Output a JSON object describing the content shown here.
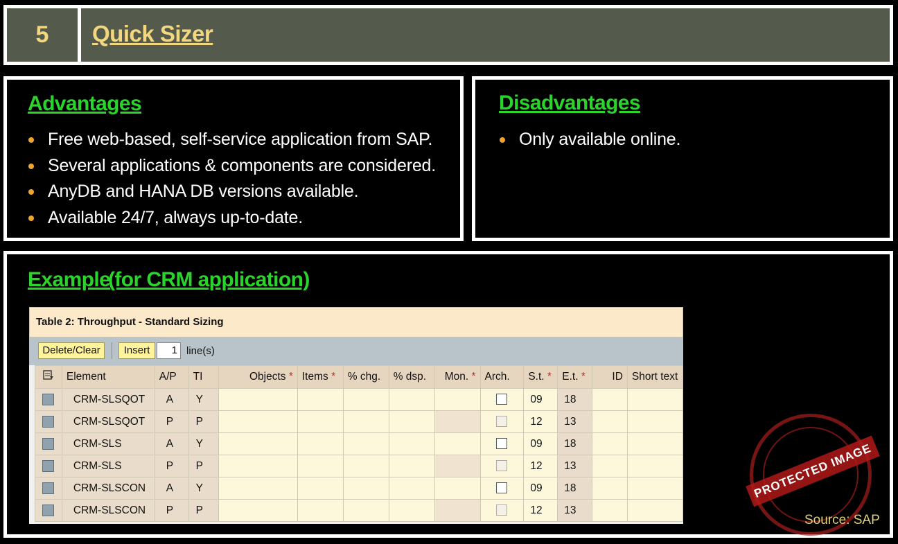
{
  "header": {
    "number": "5",
    "title": "Quick Sizer"
  },
  "advantages": {
    "title": "Advantages",
    "items": [
      "Free web-based, self-service application from SAP.",
      "Several applications & components are considered.",
      "AnyDB and HANA DB versions available.",
      "Available 24/7, always up-to-date."
    ]
  },
  "disadvantages": {
    "title": "Disadvantages",
    "items": [
      "Only available online."
    ]
  },
  "example": {
    "title": "Example",
    "subtitle": "(for CRM application)",
    "table": {
      "caption": "Table 2: Throughput - Standard Sizing",
      "toolbar": {
        "delete_label": "Delete/Clear",
        "insert_label": "Insert",
        "lines_value": "1",
        "lines_label": "line(s)"
      },
      "columns": [
        "Element",
        "A/P",
        "TI",
        "Objects",
        "Items",
        "% chg.",
        "% dsp.",
        "Mon.",
        "Arch.",
        "S.t.",
        "E.t.",
        "ID",
        "Short text"
      ],
      "rows": [
        [
          "CRM-SLSQOT",
          "A",
          "Y",
          "09",
          "18"
        ],
        [
          "CRM-SLSQOT",
          "P",
          "P",
          "12",
          "13"
        ],
        [
          "CRM-SLS",
          "A",
          "Y",
          "09",
          "18"
        ],
        [
          "CRM-SLS",
          "P",
          "P",
          "12",
          "13"
        ],
        [
          "CRM-SLSCON",
          "A",
          "Y",
          "09",
          "18"
        ],
        [
          "CRM-SLSCON",
          "P",
          "P",
          "12",
          "13"
        ]
      ]
    }
  },
  "stamp": "PROTECTED IMAGE",
  "source": "Source: SAP",
  "colors": {
    "header_bg": "#545a4c",
    "header_text": "#f3d77f",
    "section_title": "#2bd42b",
    "bullet": "#f0a52a"
  }
}
